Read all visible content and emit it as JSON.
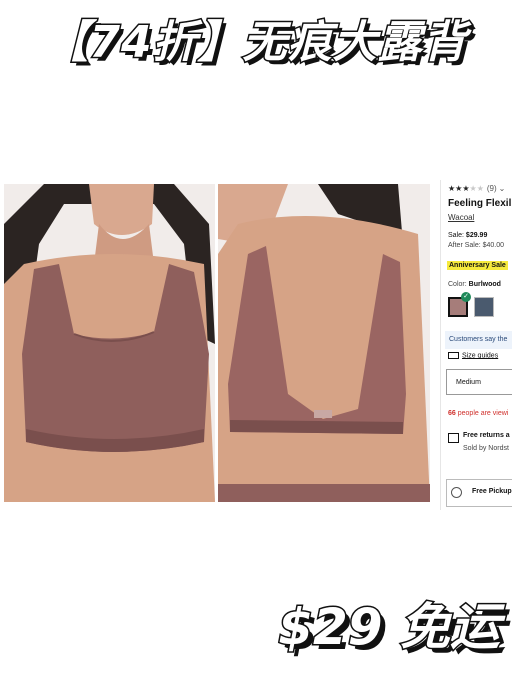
{
  "headline": "【74折】无痕大露背",
  "footer": "$29 免运",
  "product": {
    "review_count": "(9)",
    "title": "Feeling Flexil",
    "brand": "Wacoal",
    "sale_label": "Sale:",
    "sale_price": "$29.99",
    "after_sale": "After Sale: $40.00",
    "badge": "Anniversary Sale",
    "color_label": "Color:",
    "color_value": "Burlwood",
    "customers_note": "Customers say the",
    "size_guides": "Size guides",
    "size_selected": "Medium",
    "viewing_count": "66",
    "viewing_text": " people are viewi",
    "returns": "Free returns a",
    "sold_by": "Sold by Nordst",
    "pickup": "Free Pickup",
    "rating_stars": 3,
    "colors": {
      "swatch_selected": "#a67d7a",
      "swatch_other": "#4a5a6e",
      "badge_bg": "#f6ea3d",
      "alert": "#d0312d"
    }
  }
}
